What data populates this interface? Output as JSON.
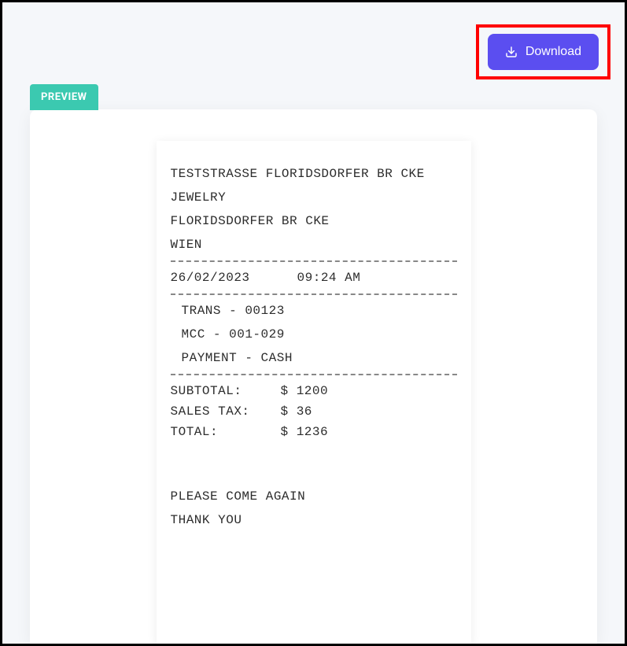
{
  "header": {
    "download_label": "Download"
  },
  "preview_badge": "PREVIEW",
  "receipt": {
    "line1": "TESTSTRASSE FLORIDSDORFER BR  CKE",
    "line2": "JEWELRY",
    "line3": "FLORIDSDORFER BR  CKE",
    "line4": "WIEN",
    "date": "26/02/2023",
    "time": "09:24 AM",
    "trans": "TRANS - 00123",
    "mcc": "MCC - 001-029",
    "payment": "PAYMENT - CASH",
    "subtotal_label": "SUBTOTAL:",
    "subtotal_value": "$ 1200",
    "salestax_label": "SALES TAX:",
    "salestax_value": "$ 36",
    "total_label": "TOTAL:",
    "total_value": "$ 1236",
    "footer1": "PLEASE COME AGAIN",
    "footer2": "THANK YOU"
  },
  "highlight": {
    "color": "#ff0000"
  }
}
